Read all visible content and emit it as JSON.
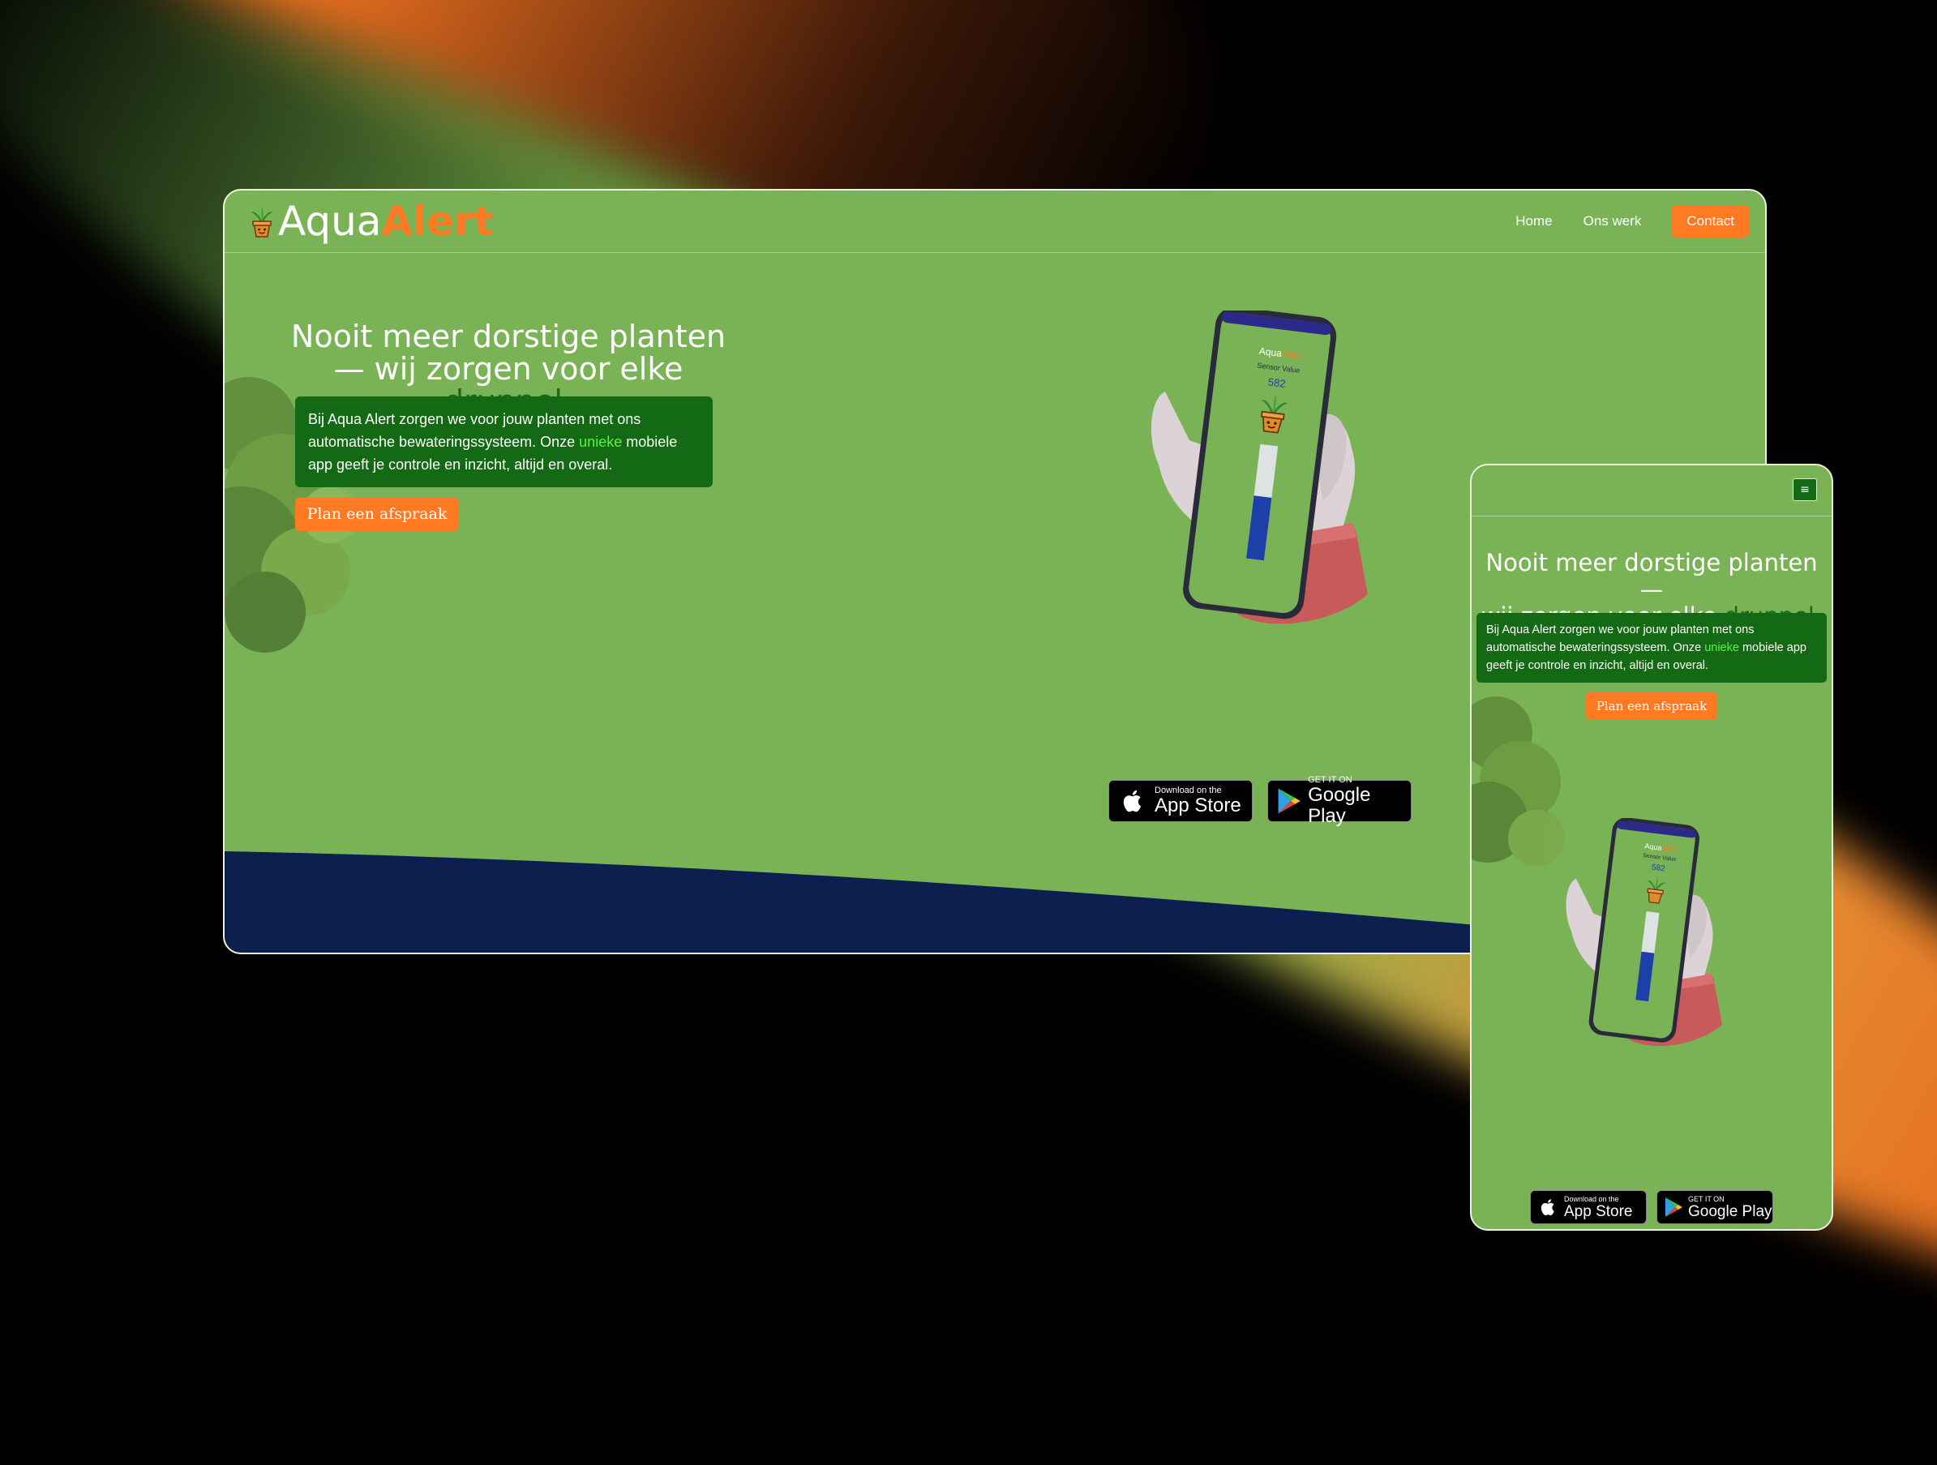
{
  "brand": {
    "name_part1": "Aqua",
    "name_part2": "Alert"
  },
  "nav": {
    "items": [
      {
        "label": "Home"
      },
      {
        "label": "Ons werk"
      }
    ],
    "contact_label": "Contact"
  },
  "hero": {
    "title_line1": "Nooit meer dorstige planten",
    "title_line2_prefix": "— wij zorgen voor elke ",
    "title_highlight": "druppel",
    "title_suffix": ".",
    "description_prefix": "Bij Aqua Alert zorgen we voor jouw planten met ons automatische bewateringssysteem. Onze ",
    "description_highlight": "unieke",
    "description_suffix": " mobiele app geeft je controle en inzicht, altijd en overal.",
    "cta_label": "Plan een afspraak"
  },
  "phone_screen": {
    "brand_part1": "Aqua",
    "brand_part2": "Alert",
    "sensor_label": "Sensor Value",
    "sensor_value": "582",
    "water_level": 0.55
  },
  "stores": {
    "apple_small": "Download on the",
    "apple_big": "App Store",
    "google_small": "GET IT ON",
    "google_big": "Google Play"
  },
  "mobile": {
    "menu_icon": "hamburger-icon",
    "title_line1": "Nooit meer dorstige planten—",
    "title_line2_prefix": "wij zorgen voor elke ",
    "title_highlight": "druppel",
    "title_suffix": "."
  },
  "colors": {
    "page_green": "#7ab356",
    "dark_green": "#146a14",
    "accent_orange": "#ff7a22",
    "wave_navy": "#0d1f4f",
    "highlight_green": "#5cf04a"
  }
}
